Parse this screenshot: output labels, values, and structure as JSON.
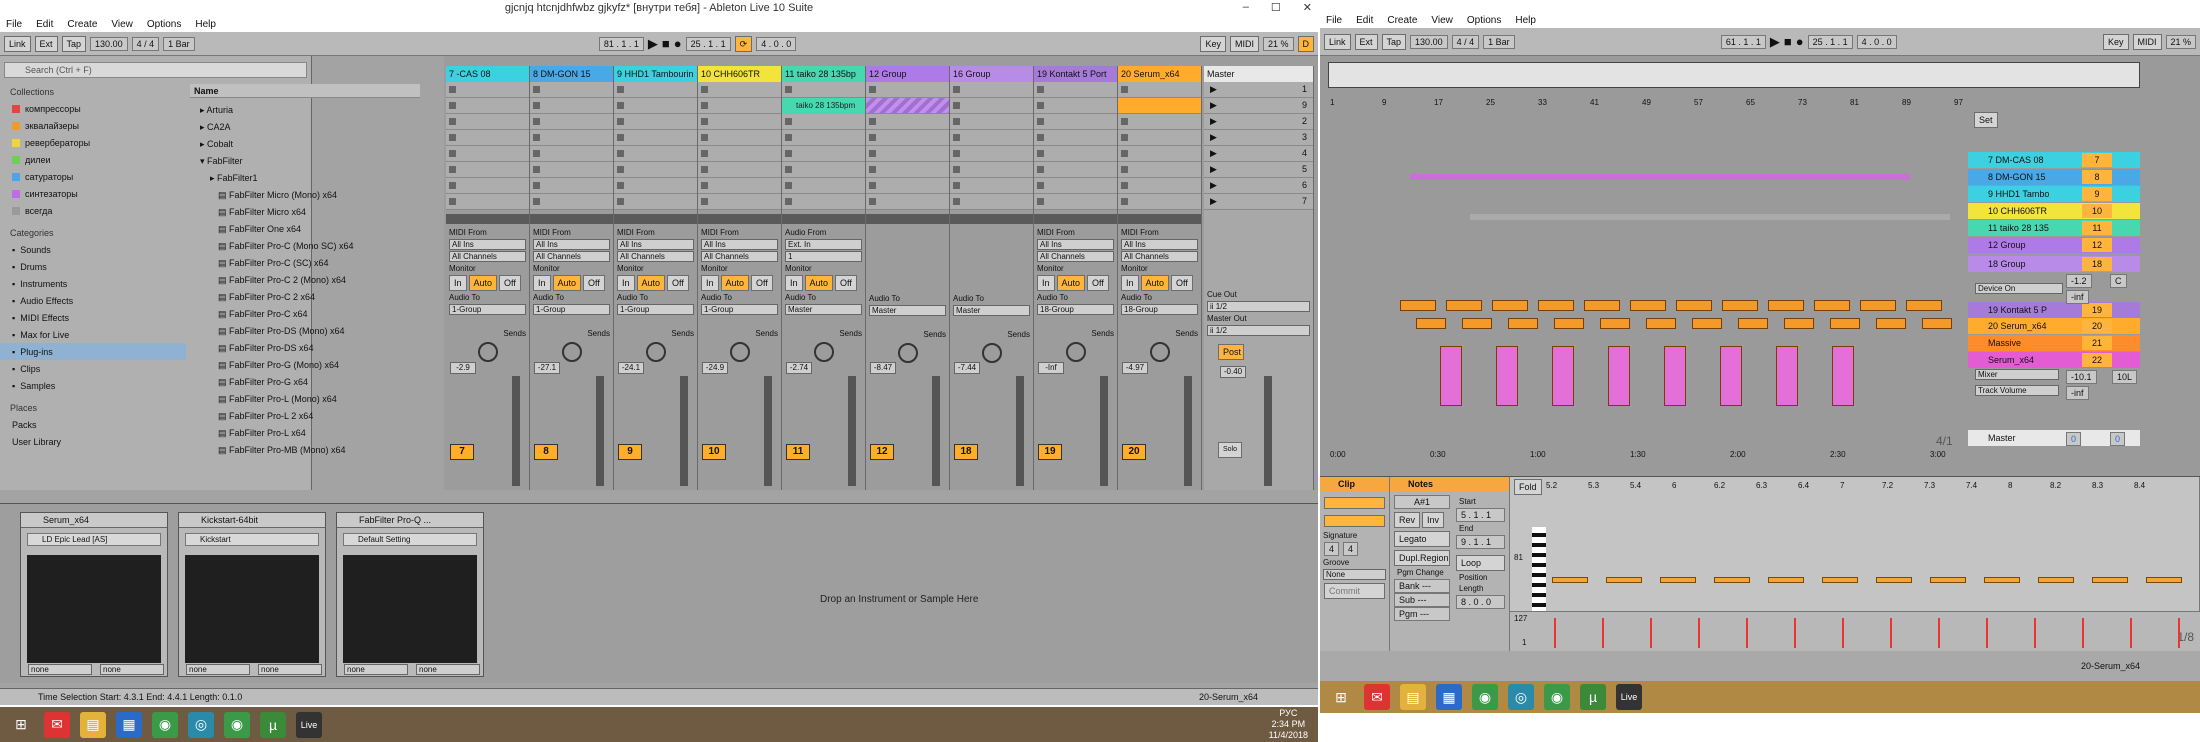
{
  "left_window": {
    "title": "gjcnjq htcnjdhfwbz gjkyfz* [внутри тебя] - Ableton Live 10 Suite",
    "menu": [
      "File",
      "Edit",
      "Create",
      "View",
      "Options",
      "Help"
    ],
    "control": {
      "link": "Link",
      "ext": "Ext",
      "tap": "Tap",
      "tempo": "130.00",
      "sig": "4 / 4",
      "bar": "1 Bar",
      "pos": "81 . 1 . 1",
      "loop_start": "25 . 1 . 1",
      "loop_len": "4 . 0 . 0",
      "key": "Key",
      "midi": "MIDI",
      "cpu": "21 %",
      "d": "D"
    },
    "browser": {
      "search": "Search (Ctrl + F)",
      "collections_title": "Collections",
      "collections": [
        {
          "label": "компрессоры",
          "color": "#e3453f"
        },
        {
          "label": "эквалайзеры",
          "color": "#f19a2a"
        },
        {
          "label": "ревербераторы",
          "color": "#f1d43a"
        },
        {
          "label": "дилеи",
          "color": "#6fcf52"
        },
        {
          "label": "сатураторы",
          "color": "#4fa4e8"
        },
        {
          "label": "синтезаторы",
          "color": "#c26be8"
        },
        {
          "label": "всегда",
          "color": "#9a9a9a"
        }
      ],
      "categories_title": "Categories",
      "categories": [
        "Sounds",
        "Drums",
        "Instruments",
        "Audio Effects",
        "MIDI Effects",
        "Max for Live",
        "Plug-ins",
        "Clips",
        "Samples"
      ],
      "places_title": "Places",
      "places": [
        "Packs",
        "User Library"
      ],
      "name_header": "Name",
      "folders": [
        "Arturia",
        "CA2A",
        "Cobalt",
        "FabFilter",
        "FabFilter1"
      ],
      "files": [
        "FabFilter Micro (Mono) x64",
        "FabFilter Micro x64",
        "FabFilter One x64",
        "FabFilter Pro-C (Mono SC) x64",
        "FabFilter Pro-C (SC) x64",
        "FabFilter Pro-C 2 (Mono) x64",
        "FabFilter Pro-C 2 x64",
        "FabFilter Pro-C x64",
        "FabFilter Pro-DS (Mono) x64",
        "FabFilter Pro-DS x64",
        "FabFilter Pro-G (Mono) x64",
        "FabFilter Pro-G x64",
        "FabFilter Pro-L (Mono) x64",
        "FabFilter Pro-L 2 x64",
        "FabFilter Pro-L x64",
        "FabFilter Pro-MB (Mono) x64"
      ]
    },
    "tracks": [
      {
        "name": "7 -CAS 08",
        "color": "#3cd1e0",
        "num": "7",
        "vol": "-2.9",
        "in": "MIDI From",
        "inv": "All Ins",
        "ch": "All Channels",
        "out": "1-Group"
      },
      {
        "name": "8 DM-GON 15",
        "color": "#4aa8e6",
        "num": "8",
        "vol": "-27.1",
        "in": "MIDI From",
        "inv": "All Ins",
        "ch": "All Channels",
        "out": "1-Group"
      },
      {
        "name": "9 HHD1 Tambourin",
        "color": "#3cd1e0",
        "num": "9",
        "vol": "-24.1",
        "in": "MIDI From",
        "inv": "All Ins",
        "ch": "All Channels",
        "out": "1-Group"
      },
      {
        "name": "10 CHH606TR",
        "color": "#f2e43a",
        "num": "10",
        "vol": "-24.9",
        "in": "MIDI From",
        "inv": "All Ins",
        "ch": "All Channels",
        "out": "1-Group"
      },
      {
        "name": "11 taiko 28 135bp",
        "color": "#48d8b0",
        "num": "11",
        "vol": "-2.74",
        "in": "Audio From",
        "inv": "Ext. In",
        "ch": "1",
        "out": "Master"
      },
      {
        "name": "12 Group",
        "color": "#ae7ae8",
        "num": "12",
        "vol": "-8.47",
        "in": "",
        "inv": "",
        "ch": "",
        "out": "Master"
      },
      {
        "name": "16 Group",
        "color": "#b88be8",
        "num": "18",
        "vol": "-7.44",
        "in": "",
        "inv": "",
        "ch": "",
        "out": "Master"
      },
      {
        "name": "19 Kontakt 5 Port",
        "color": "#a67ad8",
        "num": "19",
        "vol": "-Inf",
        "in": "MIDI From",
        "inv": "All Ins",
        "ch": "All Channels",
        "out": "18-Group"
      },
      {
        "name": "20 Serum_x64",
        "color": "#ffab2e",
        "num": "20",
        "vol": "-4.97",
        "in": "MIDI From",
        "inv": "All Ins",
        "ch": "All Channels",
        "out": "18-Group"
      }
    ],
    "clip_taiko": "taiko 28 135bpm",
    "master": {
      "name": "Master",
      "vol": "-0.40",
      "scenes": [
        "1",
        "9",
        "2",
        "3",
        "4",
        "5",
        "6",
        "7"
      ],
      "cue": "Cue Out",
      "cue_v": "ii 1/2",
      "mout": "Master Out",
      "mout_v": "ii 1/2",
      "post": "Post",
      "solo": "Solo"
    },
    "labels": {
      "monitor": "Monitor",
      "in": "In",
      "auto": "Auto",
      "off": "Off",
      "audio_to": "Audio To",
      "sends": "Sends",
      "drop": "Drop an Instrument or Sample Here"
    },
    "devices": [
      {
        "name": "Serum_x64",
        "preset": "LD Epic Lead [AS]",
        "a": "none",
        "b": "none"
      },
      {
        "name": "Kickstart-64bit",
        "preset": "Kickstart",
        "a": "none",
        "b": "none"
      },
      {
        "name": "FabFilter Pro-Q ...",
        "preset": "Default Setting",
        "a": "none",
        "b": "none"
      }
    ],
    "status": "Time Selection   Start: 4.3.1   End: 4.4.1   Length: 0.1.0",
    "status_track": "20-Serum_x64",
    "taskbar": {
      "time": "2:34 PM",
      "date": "11/4/2018",
      "lang": "РУС"
    }
  },
  "right_window": {
    "menu": [
      "File",
      "Edit",
      "Create",
      "View",
      "Options",
      "Help"
    ],
    "control": {
      "link": "Link",
      "ext": "Ext",
      "tap": "Tap",
      "tempo": "130.00",
      "sig": "4 / 4",
      "bar": "1 Bar",
      "pos": "61 . 1 . 1",
      "loop_start": "25 . 1 . 1",
      "loop_len": "4 . 0 . 0",
      "key": "Key",
      "midi": "MIDI",
      "cpu": "21 %"
    },
    "ruler": [
      "1",
      "9",
      "17",
      "25",
      "33",
      "41",
      "49",
      "57",
      "65",
      "73",
      "81",
      "89",
      "97"
    ],
    "time_ruler": [
      "0:00",
      "0:30",
      "1:00",
      "1:30",
      "2:00",
      "2:30",
      "3:00"
    ],
    "set": "Set",
    "tracks": [
      {
        "name": "7 DM-CAS 08",
        "color": "#3cd1e0",
        "num": "7"
      },
      {
        "name": "8 DM-GON 15",
        "color": "#4aa8e6",
        "num": "8"
      },
      {
        "name": "9 HHD1 Tambo",
        "color": "#3cd1e0",
        "num": "9"
      },
      {
        "name": "10 CHH606TR",
        "color": "#f2e43a",
        "num": "10"
      },
      {
        "name": "11 taiko 28 135",
        "color": "#48d8b0",
        "num": "11"
      },
      {
        "name": "12 Group",
        "color": "#ae7ae8",
        "num": "12"
      },
      {
        "name": "18 Group",
        "color": "#b88be8",
        "num": "18"
      },
      {
        "name": "19 Kontakt 5 P",
        "color": "#a67ad8",
        "num": "19"
      },
      {
        "name": "20 Serum_x64",
        "color": "#ffab2e",
        "num": "20"
      },
      {
        "name": "Massive",
        "color": "#ff8c2a",
        "num": "21"
      },
      {
        "name": "Serum_x64",
        "color": "#e35cd4",
        "num": "22"
      }
    ],
    "device_on": "Device On",
    "mixer": "Mixer",
    "track_volume": "Track Volume",
    "vals": {
      "v1": "-1.2",
      "v2": "C",
      "v3": "-inf",
      "v4": "-10.1",
      "v5": "10L",
      "v6": "-inf",
      "m1": "0",
      "m2": "0"
    },
    "master": "Master",
    "fraction": "4/1",
    "fraction2": "1/8",
    "clip": {
      "clip": "Clip",
      "notes": "Notes",
      "fold": "Fold",
      "key": "A#1",
      "start": "Start",
      "end": "End",
      "signature": "Signature",
      "sig_a": "4",
      "sig_b": "4",
      "groove": "Groove",
      "none": "None",
      "commit": "Commit",
      "rev": "Rev",
      "inv": "Inv",
      "legato": "Legato",
      "dupl": "Dupl.Region",
      "loop": "Loop",
      "position": "Position",
      "length": "Length",
      "pgm": "Pgm Change",
      "bank": "Bank ---",
      "sub": "Sub ---",
      "pgm2": "Pgm ---",
      "note_label": "81",
      "vel": "127",
      "v1": "1",
      "start_v": "5 . 1 . 1",
      "end_v": "9 . 1 . 1",
      "len_v": "8 . 0 . 0"
    },
    "clip_ruler": [
      "5.2",
      "5.3",
      "5.4",
      "6",
      "6.2",
      "6.3",
      "6.4",
      "7",
      "7.2",
      "7.3",
      "7.4",
      "8",
      "8.2",
      "8.3",
      "8.4"
    ],
    "status_track": "20-Serum_x64"
  }
}
